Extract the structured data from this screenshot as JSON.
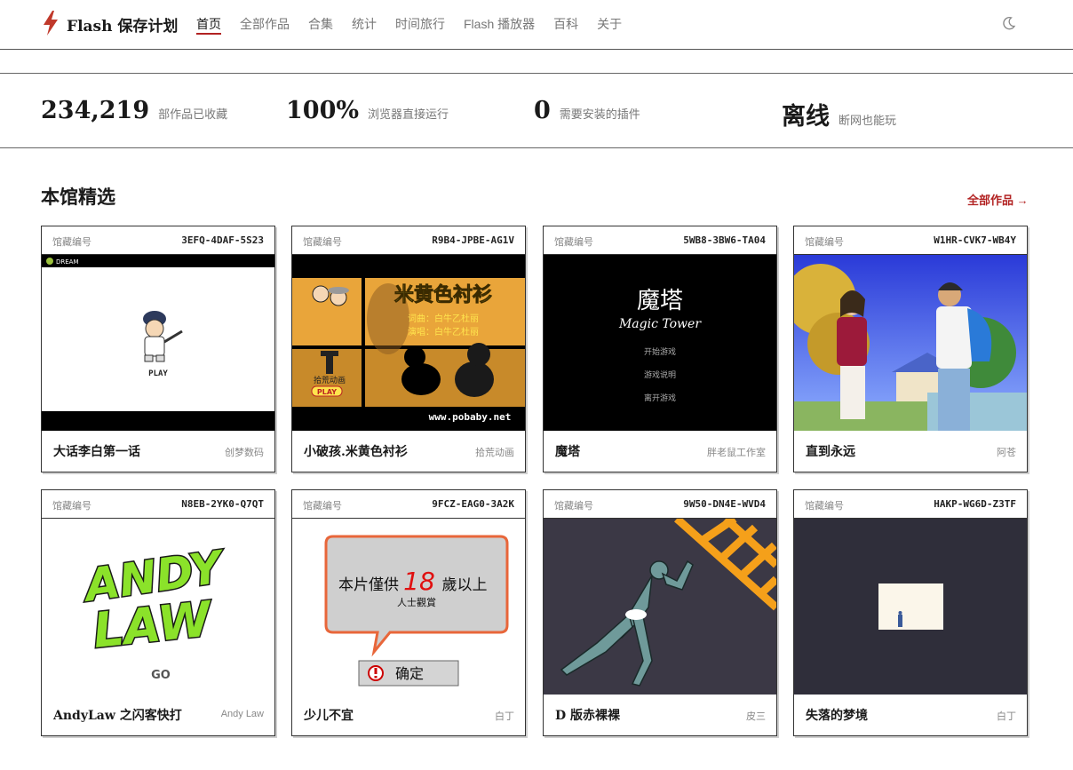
{
  "header": {
    "brand": "Flash 保存计划",
    "nav": [
      "首页",
      "全部作品",
      "合集",
      "统计",
      "时间旅行",
      "Flash 播放器",
      "百科",
      "关于"
    ],
    "active_index": 0,
    "accent": "#b22222"
  },
  "stats": [
    {
      "value": "234,219",
      "label": "部作品已收藏"
    },
    {
      "value": "100%",
      "label": "浏览器直接运行"
    },
    {
      "value": "0",
      "label": "需要安装的插件"
    },
    {
      "value": "离线",
      "label": "断网也能玩"
    }
  ],
  "section": {
    "title": "本馆精选",
    "all_link": "全部作品 →"
  },
  "card_head_label": "馆藏编号",
  "cards": [
    {
      "code": "3EFQ-4DAF-5S23",
      "title": "大话李白第一话",
      "author": "创梦数码",
      "thumb_logo": "DREAM",
      "thumb_play": "PLAY"
    },
    {
      "code": "R9B4-JPBE-AG1V",
      "title": "小破孩.米黄色衬衫",
      "author": "拾荒动画",
      "thumb_title": "米黄色衬衫",
      "thumb_line1": "词曲：白牛乙杜丽",
      "thumb_line2": "演唱：白牛乙杜丽",
      "thumb_studio": "拾荒动画",
      "thumb_play": "PLAY",
      "thumb_url": "www.pobaby.net"
    },
    {
      "code": "5WB8-3BW6-TA04",
      "title": "魔塔",
      "author": "胖老鼠工作室",
      "thumb_title": "魔塔",
      "thumb_sub": "Magic Tower",
      "thumb_menu": [
        "开始游戏",
        "游戏说明",
        "离开游戏"
      ]
    },
    {
      "code": "W1HR-CVK7-WB4Y",
      "title": "直到永远",
      "author": "阿苍"
    },
    {
      "code": "N8EB-2YK0-Q7QT",
      "title": "AndyLaw 之闪客快打",
      "author": "Andy Law",
      "thumb_line1": "ANDY",
      "thumb_line2": "LAW",
      "thumb_go": "GO"
    },
    {
      "code": "9FCZ-EAG0-3A2K",
      "title": "少儿不宜",
      "author": "白丁",
      "thumb_prefix": "本片僅供",
      "thumb_age": "18",
      "thumb_suffix": "歲以上",
      "thumb_note": "人士觀賞",
      "thumb_button": "确定"
    },
    {
      "code": "9W50-DN4E-WVD4",
      "title": "D 版赤裸裸",
      "author": "皮三"
    },
    {
      "code": "HAKP-WG6D-Z3TF",
      "title": "失落的梦境",
      "author": "白丁"
    }
  ]
}
